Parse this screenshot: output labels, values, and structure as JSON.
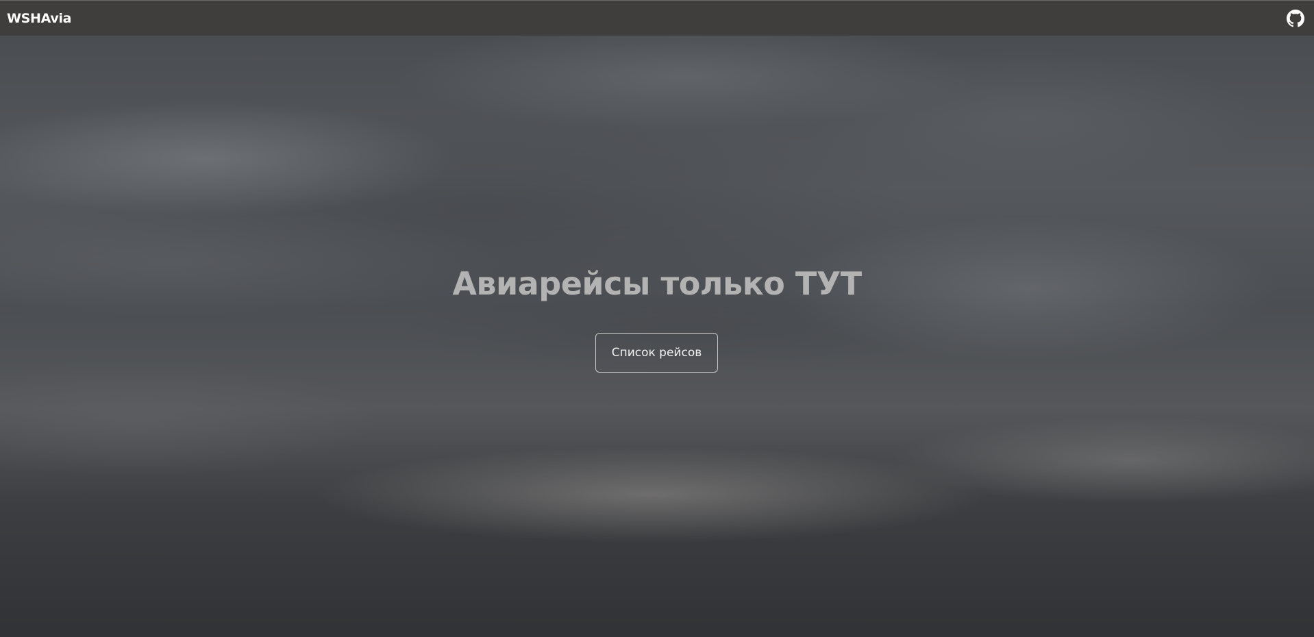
{
  "navbar": {
    "brand": "WSHAvia",
    "github_icon": "github-icon"
  },
  "hero": {
    "title": "Авиарейсы только ТУТ",
    "button_label": "Список рейсов"
  },
  "colors": {
    "navbar_bg": "#3f3e3d",
    "title_color": "#b3b3b3",
    "button_border": "#c9c9c9"
  }
}
